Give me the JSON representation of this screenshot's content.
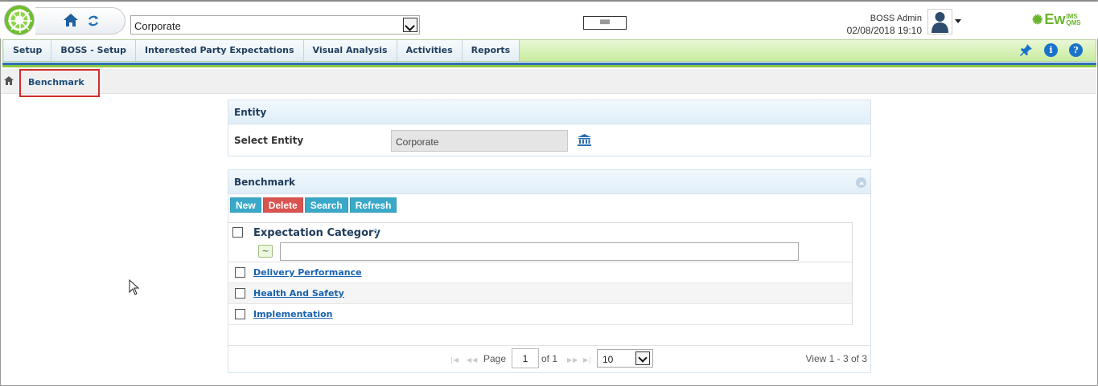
{
  "header": {
    "entity_select_value": "Corporate",
    "mini_box_text": "▒▒▒▒",
    "user_name": "BOSS Admin",
    "datetime": "02/08/2018 19:10",
    "brand": {
      "main": "Ew",
      "top": "IMS",
      "bottom": "QMS",
      "color": "#6ab42e"
    }
  },
  "nav": {
    "items": [
      {
        "label": "Setup"
      },
      {
        "label": "BOSS - Setup"
      },
      {
        "label": "Interested Party Expectations"
      },
      {
        "label": "Visual Analysis"
      },
      {
        "label": "Activities"
      },
      {
        "label": "Reports"
      }
    ],
    "icons": [
      "pin-icon",
      "info-icon",
      "help-icon"
    ]
  },
  "breadcrumb": {
    "current": "Benchmark"
  },
  "entity_panel": {
    "title": "Entity",
    "select_label": "Select Entity",
    "select_value": "Corporate"
  },
  "benchmark_panel": {
    "title": "Benchmark",
    "buttons": {
      "new": "New",
      "delete": "Delete",
      "search": "Search",
      "refresh": "Refresh"
    },
    "column_header": "Expectation Category",
    "filter_operator": "~",
    "filter_value": "",
    "rows": [
      {
        "label": "Delivery Performance"
      },
      {
        "label": "Health And Safety"
      },
      {
        "label": "Implementation"
      }
    ]
  },
  "pager": {
    "page_label": "Page",
    "page_value": "1",
    "of_label": "of 1",
    "page_size": "10",
    "view_text": "View 1 - 3 of 3"
  },
  "colors": {
    "accent_blue": "#2d6fb4",
    "accent_green": "#8cc63f",
    "button_teal": "#3aa9c9",
    "button_red": "#d9534f",
    "highlight_red": "#d22b2b"
  }
}
